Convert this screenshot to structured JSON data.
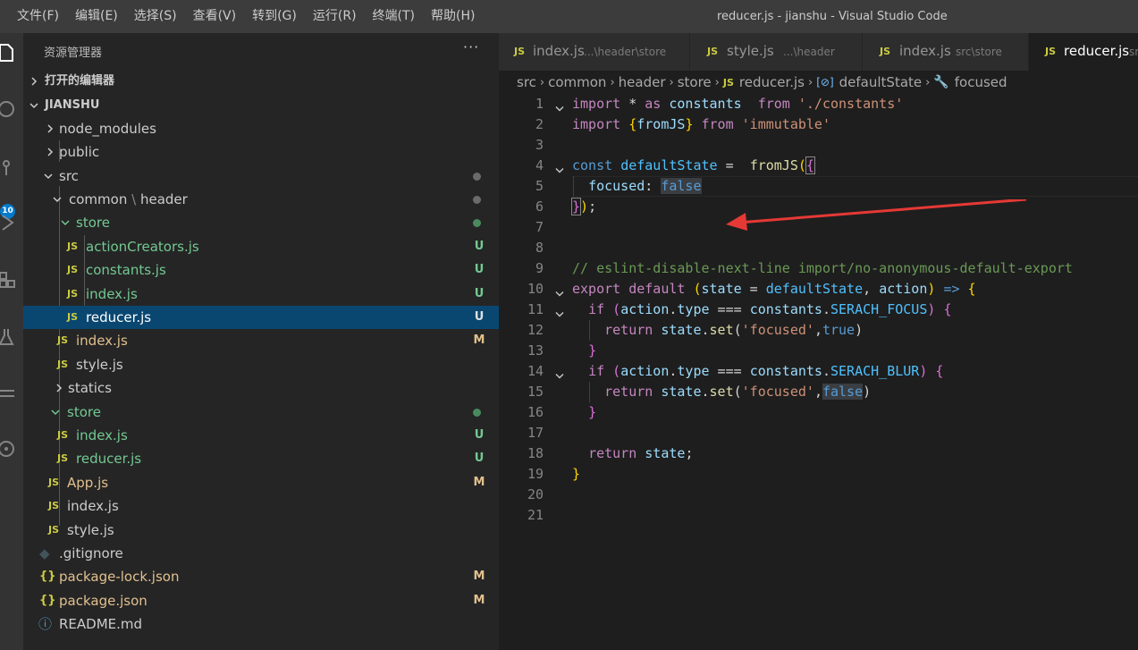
{
  "menu": [
    "文件(F)",
    "编辑(E)",
    "选择(S)",
    "查看(V)",
    "转到(G)",
    "运行(R)",
    "终端(T)",
    "帮助(H)"
  ],
  "window_title": "reducer.js - jianshu - Visual Studio Code",
  "activity": {
    "scm_badge": "10"
  },
  "sidebar": {
    "title": "资源管理器",
    "more": "···",
    "open_editors": "打开的编辑器",
    "project": "JIANSHU",
    "tree": {
      "node_modules": "node_modules",
      "public": "public",
      "src": "src",
      "common": "common",
      "common_sep": "\\",
      "header": "header",
      "store": "store",
      "actionCreators": "actionCreators.js",
      "constants": "constants.js",
      "index_store": "index.js",
      "reducer": "reducer.js",
      "index_header": "index.js",
      "style_header": "style.js",
      "statics": "statics",
      "store_src": "store",
      "index_src_store": "index.js",
      "reducer_src_store": "reducer.js",
      "app": "App.js",
      "index_src": "index.js",
      "style_src": "style.js",
      "gitignore": ".gitignore",
      "package_lock": "package-lock.json",
      "package": "package.json",
      "readme": "README.md"
    },
    "status": {
      "U": "U",
      "M": "M"
    },
    "colors": {
      "untracked": "#73c991",
      "modified": "#e2c08d",
      "selected_bg": "#094771",
      "folder_dot": "#6b6b6b"
    }
  },
  "tabs": [
    {
      "name": "index.js",
      "desc": "...\\header\\store"
    },
    {
      "name": "style.js",
      "desc": "...\\header"
    },
    {
      "name": "index.js",
      "desc": "src\\store"
    },
    {
      "name": "reducer.js",
      "desc": "sr"
    }
  ],
  "tab_icon": "JS",
  "breadcrumb": [
    "src",
    "common",
    "header",
    "store",
    "reducer.js",
    "defaultState",
    "focused"
  ],
  "code": {
    "line_numbers": [
      "1",
      "2",
      "3",
      "4",
      "5",
      "6",
      "7",
      "8",
      "9",
      "10",
      "11",
      "12",
      "13",
      "14",
      "15",
      "16",
      "17",
      "18",
      "19",
      "20",
      "21"
    ],
    "l1": {
      "a": "import",
      "b": " * ",
      "c": "as",
      "d": " constants  ",
      "e": "from",
      "f": " ",
      "g": "'./constants'"
    },
    "l2": {
      "a": "import",
      "b": " {",
      "c": "fromJS",
      "d": "} ",
      "e": "from",
      "f": " ",
      "g": "'immutable'"
    },
    "l4": {
      "a": "const",
      "b": " ",
      "c": "defaultState",
      "d": " =  ",
      "e": "fromJS",
      "f": "(",
      "g": "{"
    },
    "l5": {
      "a": "  ",
      "b": "focused",
      "c": ": ",
      "d": "false"
    },
    "l6": {
      "a": "}",
      "b": ")",
      "c": ";"
    },
    "l9": "// eslint-disable-next-line import/no-anonymous-default-export",
    "l10": {
      "a": "export",
      "b": " ",
      "c": "default",
      "d": " (",
      "e": "state",
      "f": " = ",
      "g": "defaultState",
      "h": ", ",
      "i": "action",
      "j": ") ",
      "k": "=>",
      "l": " ",
      "m": "{"
    },
    "l11": {
      "a": "  ",
      "b": "if",
      "c": " (",
      "d": "action",
      "e": ".",
      "f": "type",
      "g": " === ",
      "h": "constants",
      "i": ".",
      "j": "SERACH_FOCUS",
      "k": ") ",
      "l": "{"
    },
    "l12": {
      "a": "    ",
      "b": "return",
      "c": " ",
      "d": "state",
      "e": ".",
      "f": "set",
      "g": "(",
      "h": "'focused'",
      "i": ",",
      "j": "true",
      "k": ")"
    },
    "l13": {
      "a": "  ",
      "b": "}"
    },
    "l14": {
      "a": "  ",
      "b": "if",
      "c": " (",
      "d": "action",
      "e": ".",
      "f": "type",
      "g": " === ",
      "h": "constants",
      "i": ".",
      "j": "SERACH_BLUR",
      "k": ") ",
      "l": "{"
    },
    "l15": {
      "a": "    ",
      "b": "return",
      "c": " ",
      "d": "state",
      "e": ".",
      "f": "set",
      "g": "(",
      "h": "'focused'",
      "i": ",",
      "j": "false",
      "k": ")"
    },
    "l16": {
      "a": "  ",
      "b": "}"
    },
    "l18": {
      "a": "  ",
      "b": "return",
      "c": " ",
      "d": "state",
      "e": ";"
    },
    "l19": "}"
  },
  "annotation": {
    "arrow_color": "#e53935"
  }
}
